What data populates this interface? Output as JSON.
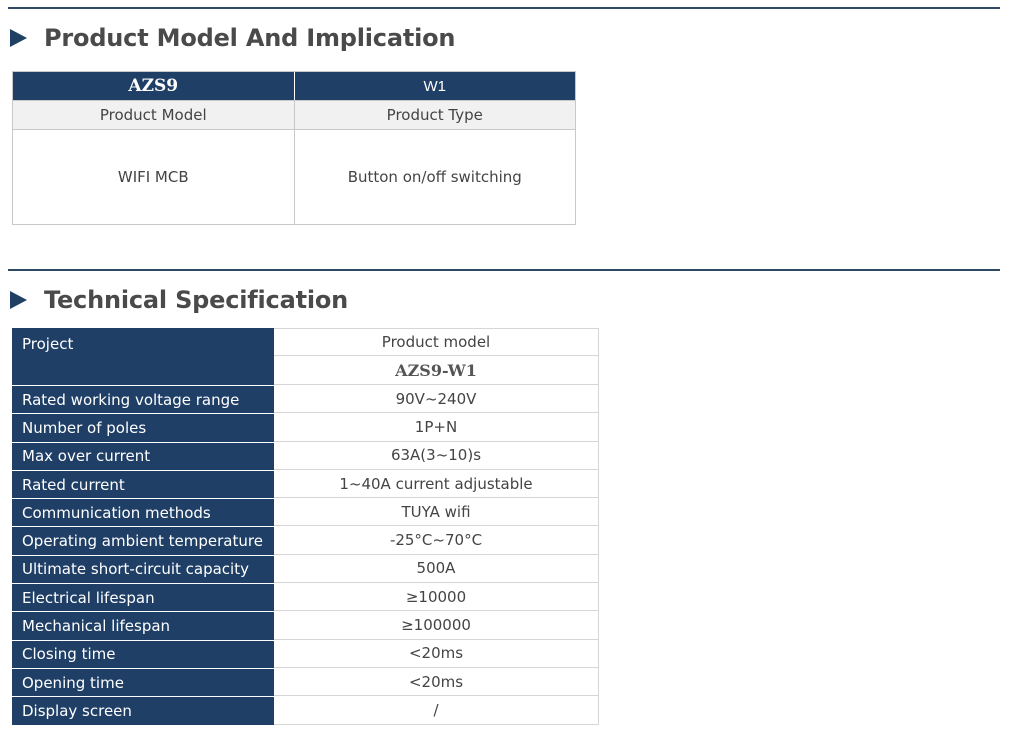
{
  "section1": {
    "title": "Product Model And Implication"
  },
  "product_table": {
    "model": "AZS9",
    "type_code": "W1",
    "model_label": "Product Model",
    "type_label": "Product Type",
    "model_value": "WIFI MCB",
    "type_value": "Button on/off switching"
  },
  "section2": {
    "title": "Technical Specification"
  },
  "spec_table": {
    "project_label": "Project",
    "product_model_label": "Product model",
    "product_model_value": "AZS9-W1",
    "rows": [
      {
        "name": "Rated working voltage range",
        "value": "90V~240V"
      },
      {
        "name": "Number of poles",
        "value": "1P+N"
      },
      {
        "name": "Max over current",
        "value": "63A(3~10)s"
      },
      {
        "name": "Rated current",
        "value": "1~40A current adjustable"
      },
      {
        "name": "Communication methods",
        "value": "TUYA wifi"
      },
      {
        "name": "Operating ambient temperature",
        "value": "-25°C~70°C"
      },
      {
        "name": "Ultimate short-circuit capacity",
        "value": "500A"
      },
      {
        "name": "Electrical lifespan",
        "value": "≥10000"
      },
      {
        "name": "Mechanical lifespan",
        "value": "≥100000"
      },
      {
        "name": "Closing time",
        "value": "<20ms"
      },
      {
        "name": "Opening time",
        "value": "<20ms"
      },
      {
        "name": "Display screen",
        "value": "/"
      }
    ]
  }
}
